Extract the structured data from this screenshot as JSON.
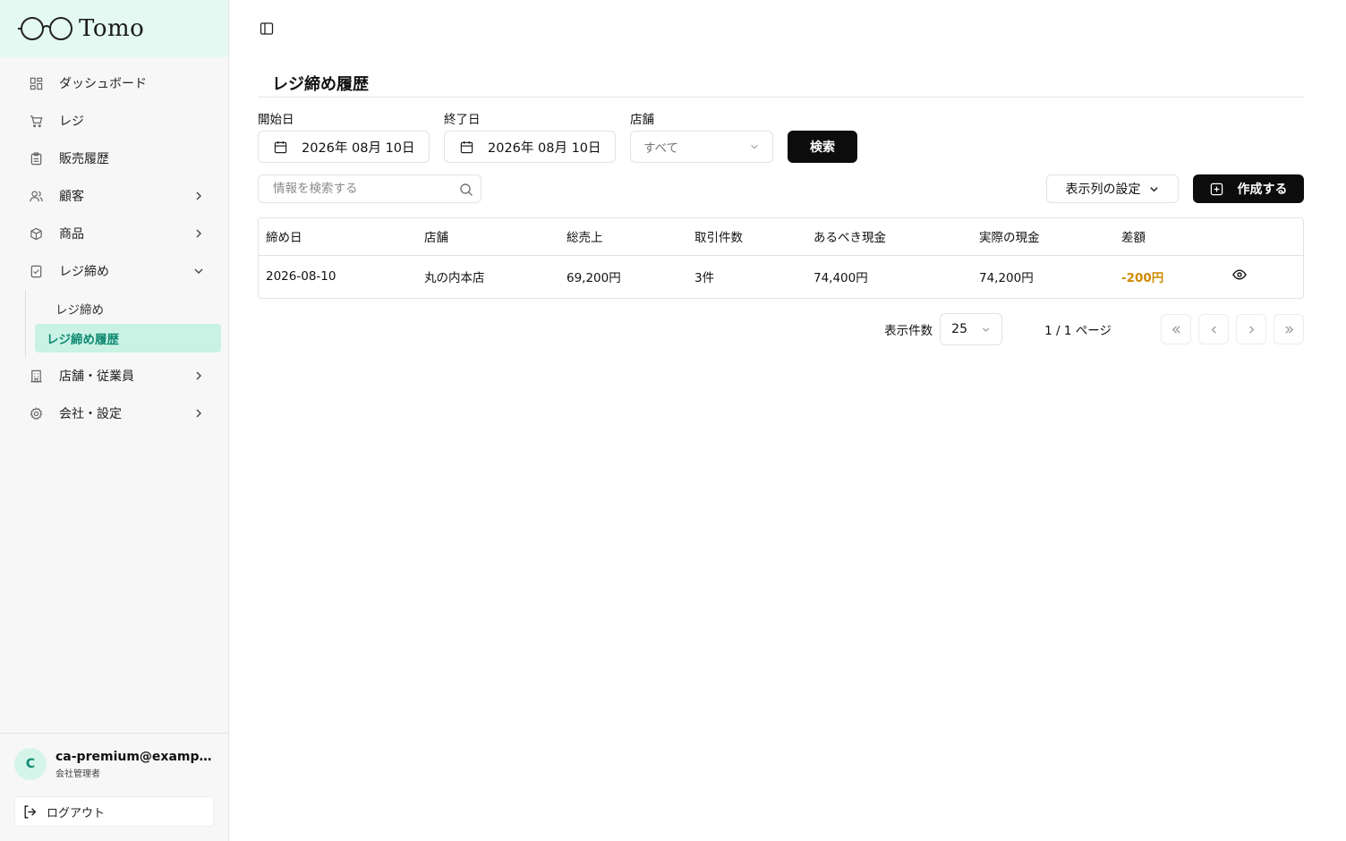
{
  "brand": {
    "name": "Tomo"
  },
  "sidebar": {
    "items": [
      {
        "label": "ダッシュボード",
        "icon": "dashboard-icon"
      },
      {
        "label": "レジ",
        "icon": "cart-icon"
      },
      {
        "label": "販売履歴",
        "icon": "clipboard-icon"
      },
      {
        "label": "顧客",
        "icon": "users-icon",
        "chevron": "right"
      },
      {
        "label": "商品",
        "icon": "box-icon",
        "chevron": "right"
      },
      {
        "label": "レジ締め",
        "icon": "register-close-icon",
        "chevron": "down"
      },
      {
        "label": "店舗・従業員",
        "icon": "building-icon",
        "chevron": "right"
      },
      {
        "label": "会社・設定",
        "icon": "gear-icon",
        "chevron": "right"
      }
    ],
    "sub_items": [
      {
        "label": "レジ締め"
      },
      {
        "label": "レジ締め履歴",
        "active": true
      }
    ],
    "user": {
      "initial": "C",
      "email": "ca-premium@example.com",
      "role": "会社管理者"
    },
    "logout_label": "ログアウト"
  },
  "main": {
    "title": "レジ締め履歴",
    "filters": {
      "start_label": "開始日",
      "start_value": "2026年 08月 10日",
      "end_label": "終了日",
      "end_value": "2026年 08月 10日",
      "store_label": "店舗",
      "store_value": "すべて",
      "search_button": "検索"
    },
    "toolbar": {
      "search_placeholder": "情報を検索する",
      "column_settings": "表示列の設定",
      "create_button": "作成する"
    },
    "table": {
      "headers": [
        "締め日",
        "店舗",
        "総売上",
        "取引件数",
        "あるべき現金",
        "実際の現金",
        "差額",
        ""
      ],
      "rows": [
        {
          "date": "2026-08-10",
          "store": "丸の内本店",
          "total_sales": "69,200円",
          "transactions": "3件",
          "expected_cash": "74,400円",
          "actual_cash": "74,200円",
          "difference": "-200円"
        }
      ],
      "negative_color": "#d08a00"
    },
    "pagination": {
      "per_page_label": "表示件数",
      "per_page_value": "25",
      "page_info": "1 / 1 ページ"
    }
  },
  "colors": {
    "accent": "#0e8a71",
    "accent_bg": "#c9f2e5",
    "logo_bg": "#e4f9f2",
    "button": "#0c0c0c"
  }
}
